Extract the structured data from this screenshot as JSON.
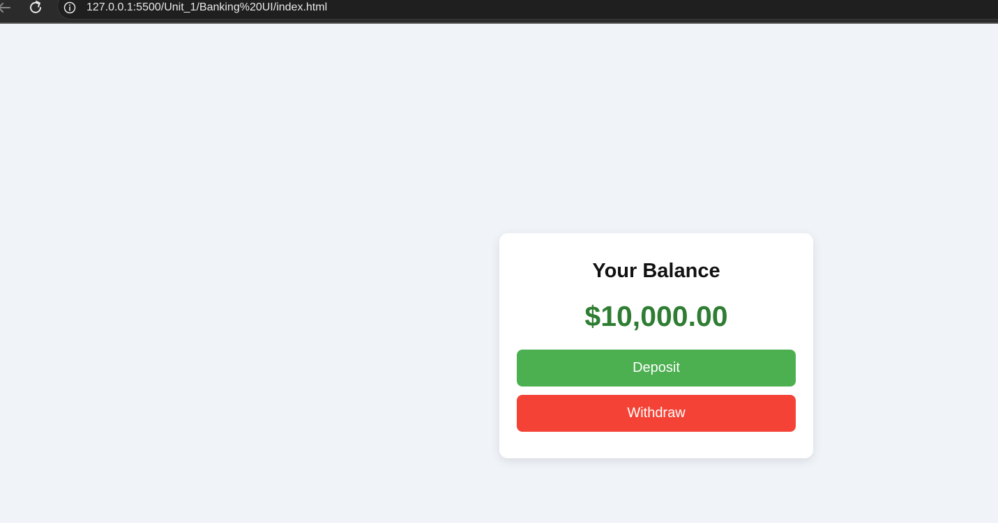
{
  "browser": {
    "url": "127.0.0.1:5500/Unit_1/Banking%20UI/index.html"
  },
  "card": {
    "title": "Your Balance",
    "balance": "$10,000.00",
    "deposit_label": "Deposit",
    "withdraw_label": "Withdraw"
  },
  "colors": {
    "page_background": "#f0f4f9",
    "balance_text": "#2e7d32",
    "deposit_button": "#4caf50",
    "withdraw_button": "#f44336"
  },
  "icons": {
    "back": "arrow-left-icon",
    "reload": "reload-icon",
    "info": "info-icon"
  }
}
